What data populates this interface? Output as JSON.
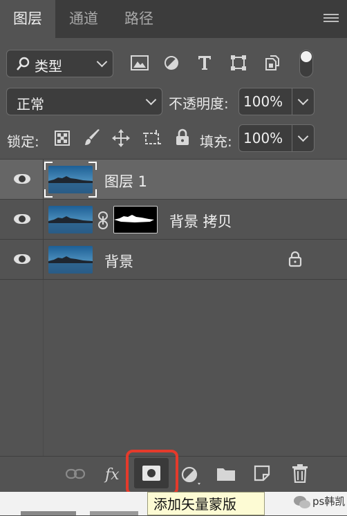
{
  "tabs": [
    {
      "label": "图层",
      "active": true
    },
    {
      "label": "通道",
      "active": false
    },
    {
      "label": "路径",
      "active": false
    }
  ],
  "filter": {
    "label": "类型"
  },
  "blend_mode": "正常",
  "opacity": {
    "label": "不透明度:",
    "value": "100%"
  },
  "lock": {
    "label": "锁定:"
  },
  "fill": {
    "label": "填充:",
    "value": "100%"
  },
  "layers": [
    {
      "name": "图层 1",
      "selected": true,
      "locked": false,
      "has_mask": false
    },
    {
      "name": "背景 拷贝",
      "selected": false,
      "locked": false,
      "has_mask": true
    },
    {
      "name": "背景",
      "selected": false,
      "locked": true,
      "has_mask": false
    }
  ],
  "tooltip": "添加矢量蒙版",
  "watermark": "ps韩凯",
  "colors": {
    "panel": "#535353",
    "tabbar": "#3c3c3c",
    "highlight": "#e53a2b",
    "tooltip_bg": "#fdfbd4"
  }
}
